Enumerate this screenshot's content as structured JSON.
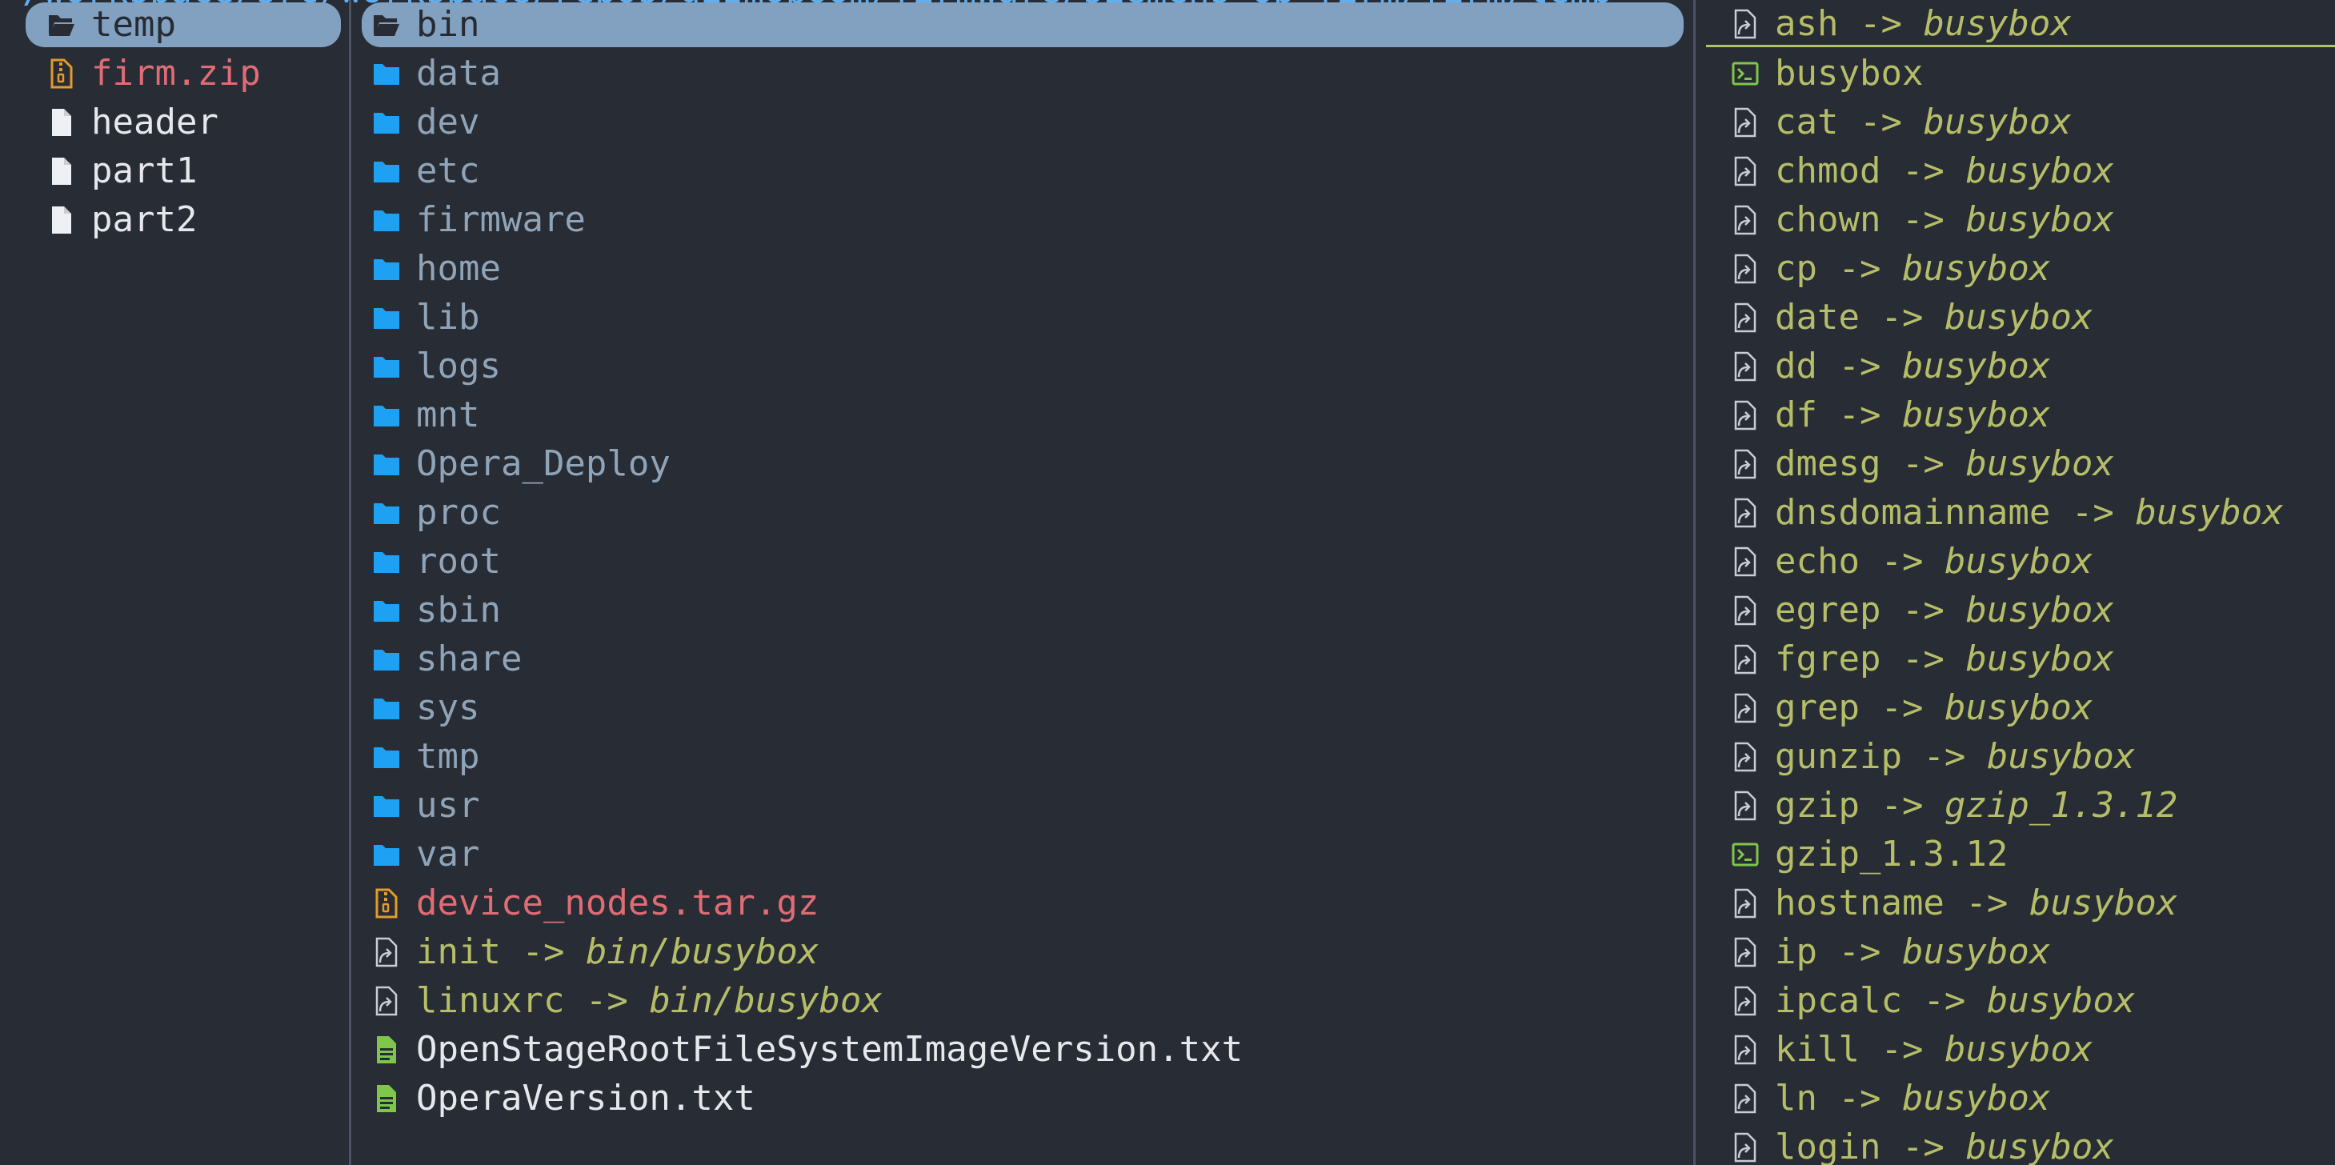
{
  "path": "/workspace/src/workspace/repos/gizmoboom/firmware/siemens_op_firm/firm/temp",
  "colors": {
    "background": "#282c34",
    "folder": "#1ea1f2",
    "dir_text": "#8fa4b8",
    "file_text": "#e6e8ec",
    "archive": "#e39b2b",
    "archive_text": "#e06c75",
    "link_text": "#b5bd68",
    "exec": "#7ec74a",
    "doc": "#7ec74a",
    "selection": "#82a0bf",
    "divider": "#4b5263"
  },
  "left_pane": {
    "items": [
      {
        "name": "temp",
        "kind": "dir-open",
        "selected": true
      },
      {
        "name": "firm.zip",
        "kind": "archive"
      },
      {
        "name": "header",
        "kind": "file"
      },
      {
        "name": "part1",
        "kind": "file"
      },
      {
        "name": "part2",
        "kind": "file"
      }
    ]
  },
  "middle_pane": {
    "items": [
      {
        "name": "bin",
        "kind": "dir-open",
        "selected": true
      },
      {
        "name": "data",
        "kind": "dir"
      },
      {
        "name": "dev",
        "kind": "dir"
      },
      {
        "name": "etc",
        "kind": "dir"
      },
      {
        "name": "firmware",
        "kind": "dir"
      },
      {
        "name": "home",
        "kind": "dir"
      },
      {
        "name": "lib",
        "kind": "dir"
      },
      {
        "name": "logs",
        "kind": "dir"
      },
      {
        "name": "mnt",
        "kind": "dir"
      },
      {
        "name": "Opera_Deploy",
        "kind": "dir"
      },
      {
        "name": "proc",
        "kind": "dir"
      },
      {
        "name": "root",
        "kind": "dir"
      },
      {
        "name": "sbin",
        "kind": "dir"
      },
      {
        "name": "share",
        "kind": "dir"
      },
      {
        "name": "sys",
        "kind": "dir"
      },
      {
        "name": "tmp",
        "kind": "dir"
      },
      {
        "name": "usr",
        "kind": "dir"
      },
      {
        "name": "var",
        "kind": "dir"
      },
      {
        "name": "device_nodes.tar.gz",
        "kind": "archive"
      },
      {
        "name": "init",
        "kind": "link",
        "target": "bin/busybox"
      },
      {
        "name": "linuxrc",
        "kind": "link",
        "target": "bin/busybox"
      },
      {
        "name": "OpenStageRootFileSystemImageVersion.txt",
        "kind": "doc"
      },
      {
        "name": "OperaVersion.txt",
        "kind": "doc"
      }
    ]
  },
  "right_pane": {
    "items": [
      {
        "name": "ash",
        "kind": "link",
        "target": "busybox",
        "hover": true
      },
      {
        "name": "busybox",
        "kind": "exec"
      },
      {
        "name": "cat",
        "kind": "link",
        "target": "busybox"
      },
      {
        "name": "chmod",
        "kind": "link",
        "target": "busybox"
      },
      {
        "name": "chown",
        "kind": "link",
        "target": "busybox"
      },
      {
        "name": "cp",
        "kind": "link",
        "target": "busybox"
      },
      {
        "name": "date",
        "kind": "link",
        "target": "busybox"
      },
      {
        "name": "dd",
        "kind": "link",
        "target": "busybox"
      },
      {
        "name": "df",
        "kind": "link",
        "target": "busybox"
      },
      {
        "name": "dmesg",
        "kind": "link",
        "target": "busybox"
      },
      {
        "name": "dnsdomainname",
        "kind": "link",
        "target": "busybox"
      },
      {
        "name": "echo",
        "kind": "link",
        "target": "busybox"
      },
      {
        "name": "egrep",
        "kind": "link",
        "target": "busybox"
      },
      {
        "name": "fgrep",
        "kind": "link",
        "target": "busybox"
      },
      {
        "name": "grep",
        "kind": "link",
        "target": "busybox"
      },
      {
        "name": "gunzip",
        "kind": "link",
        "target": "busybox"
      },
      {
        "name": "gzip",
        "kind": "link",
        "target": "gzip_1.3.12"
      },
      {
        "name": "gzip_1.3.12",
        "kind": "exec"
      },
      {
        "name": "hostname",
        "kind": "link",
        "target": "busybox"
      },
      {
        "name": "ip",
        "kind": "link",
        "target": "busybox"
      },
      {
        "name": "ipcalc",
        "kind": "link",
        "target": "busybox"
      },
      {
        "name": "kill",
        "kind": "link",
        "target": "busybox"
      },
      {
        "name": "ln",
        "kind": "link",
        "target": "busybox"
      },
      {
        "name": "login",
        "kind": "link",
        "target": "busybox"
      }
    ]
  },
  "link_arrow": " -> "
}
